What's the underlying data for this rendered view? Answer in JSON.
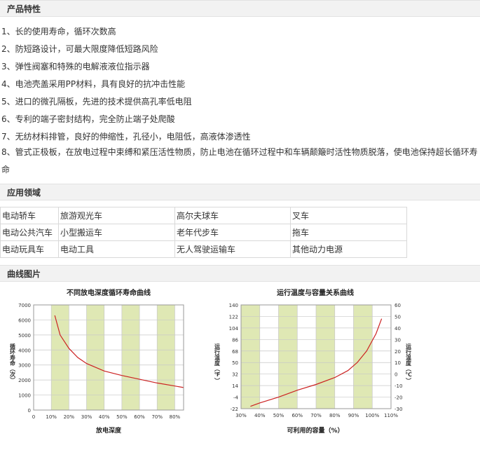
{
  "sections": {
    "features_title": "产品特性",
    "apps_title": "应用领域",
    "curves_title": "曲线图片"
  },
  "features": [
    "1、长的使用寿命，循环次数高",
    "2、防短路设计，可最大限度降低短路风险",
    "3、弹性阀塞和特殊的电解液液位指示器",
    "4、电池壳盖采用PP材料，具有良好的抗冲击性能",
    "5、进口的微孔隔板，先进的技术提供高孔率低电阻",
    "6、专利的端子密封结构，完全防止端子处爬酸",
    "7、无纺材料排管，良好的伸缩性，孔径小，电阻低，高液体渗透性",
    "8、管式正极板，在放电过程中束缚和紧压活性物质，防止电池在循环过程中和车辆颠簸时活性物质脱落，使电池保持超长循环寿命"
  ],
  "applications": [
    [
      "电动轿车",
      "旅游观光车",
      "高尔夫球车",
      "叉车"
    ],
    [
      "电动公共汽车",
      "小型搬运车",
      "老年代步车",
      "拖车"
    ],
    [
      "电动玩具车",
      "电动工具",
      "无人驾驶运输车",
      "其他动力电源"
    ]
  ],
  "chart_data": [
    {
      "type": "line",
      "title": "不同放电深度循环寿命曲线",
      "xlabel": "放电深度",
      "ylabel": "循环寿命（次）",
      "x_ticks": [
        "0",
        "10%",
        "20%",
        "30%",
        "40%",
        "50%",
        "60%",
        "70%",
        "80%"
      ],
      "y_ticks": [
        "0",
        "1000",
        "2000",
        "3000",
        "4000",
        "5000",
        "6000",
        "7000"
      ],
      "xlim": [
        0,
        85
      ],
      "ylim": [
        0,
        7000
      ],
      "band_color": "#dfe8b4",
      "line_color": "#cc2222",
      "series": [
        {
          "x": [
            12,
            15,
            20,
            25,
            30,
            35,
            40,
            50,
            60,
            70,
            80,
            85
          ],
          "values": [
            6300,
            5000,
            4100,
            3500,
            3100,
            2850,
            2600,
            2300,
            2050,
            1800,
            1600,
            1500
          ]
        }
      ]
    },
    {
      "type": "line",
      "title": "运行温度与容量关系曲线",
      "xlabel": "可利用的容量（%）",
      "ylabel_left": "运行温度（℉）",
      "ylabel_right": "运行温度（℃）",
      "x_ticks": [
        "30%",
        "40%",
        "50%",
        "60%",
        "70%",
        "80%",
        "90%",
        "100%",
        "110%"
      ],
      "y_ticks_left": [
        "-22",
        "-4",
        "14",
        "32",
        "50",
        "68",
        "86",
        "104",
        "122",
        "140"
      ],
      "y_ticks_right": [
        "-30",
        "-20",
        "-10",
        "0",
        "10",
        "20",
        "30",
        "40",
        "50",
        "60"
      ],
      "xlim": [
        30,
        110
      ],
      "ylim_celsius": [
        -30,
        60
      ],
      "band_color": "#dfe8b4",
      "line_color": "#cc2222",
      "series": [
        {
          "x": [
            35,
            40,
            50,
            60,
            70,
            80,
            87,
            92,
            97,
            102,
            105
          ],
          "values": [
            -28,
            -25,
            -20,
            -14,
            -9,
            -3,
            3,
            10,
            20,
            35,
            48
          ]
        }
      ]
    }
  ]
}
